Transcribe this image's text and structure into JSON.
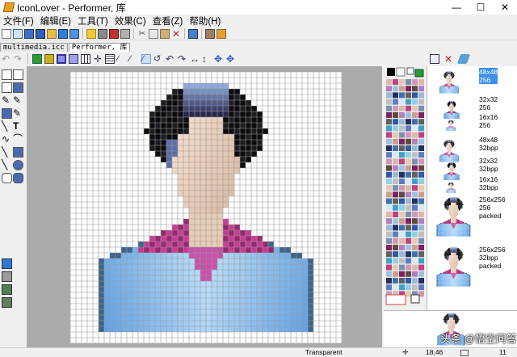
{
  "window": {
    "title": "IconLover - Performer, 库",
    "minimize": "—",
    "maximize": "☐",
    "close": "✕"
  },
  "menu": [
    "文件(F)",
    "编辑(E)",
    "工具(T)",
    "效果(C)",
    "查看(Z)",
    "帮助(H)"
  ],
  "tabs": [
    {
      "label": "multimedia.icc",
      "active": false
    },
    {
      "label": "Performer, 库",
      "active": true
    }
  ],
  "formats": [
    {
      "label": "48x48\n256",
      "selected": true
    },
    {
      "label": "32x32\n256",
      "selected": false
    },
    {
      "label": "16x16\n256",
      "selected": false
    },
    {
      "label": "48x48\n32bpp",
      "selected": false
    },
    {
      "label": "32x32\n32bpp",
      "selected": false
    },
    {
      "label": "16x16\n32bpp",
      "selected": false
    },
    {
      "label": "256x256\n256\npacked",
      "selected": false
    },
    {
      "label": "256x256\n32bpp\npacked",
      "selected": false
    }
  ],
  "status": {
    "mode": "Transparent",
    "coords": "18,46",
    "zoom": "11"
  },
  "watermark": "头条 @悟空问答",
  "colors": {
    "accent": "#3c8fe8",
    "canvas_grid": "#9a9a9a",
    "frame": "#ababab"
  },
  "icons": [
    "new-icon",
    "open-icon",
    "save-icon",
    "undo-icon",
    "redo-icon",
    "grid-icon",
    "pencil-icon",
    "eraser-icon",
    "fill-icon",
    "text-icon",
    "line-icon",
    "rect-icon",
    "ellipse-icon"
  ]
}
